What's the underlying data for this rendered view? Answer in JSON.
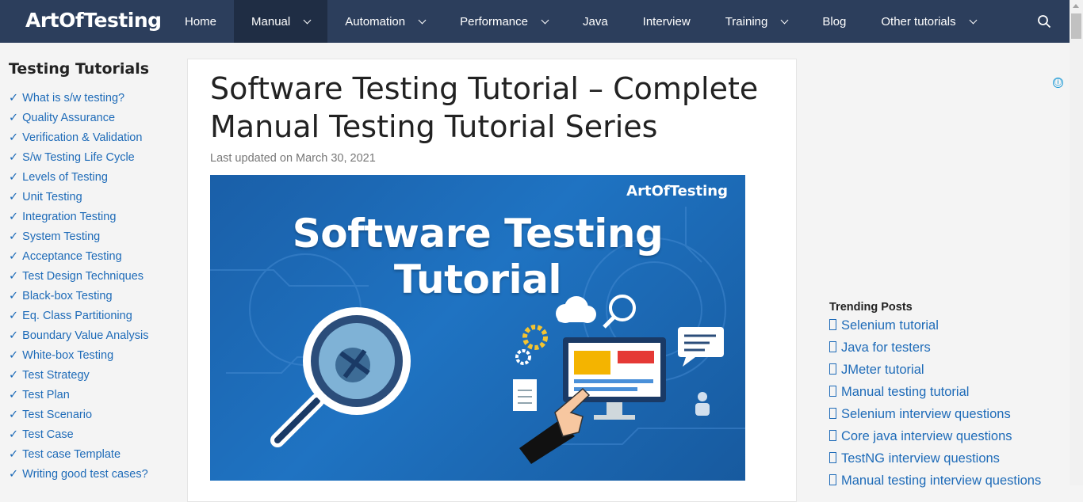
{
  "header": {
    "logo": "ArtOfTesting",
    "nav": [
      {
        "label": "Home",
        "dropdown": false,
        "active": false
      },
      {
        "label": "Manual",
        "dropdown": true,
        "active": true
      },
      {
        "label": "Automation",
        "dropdown": true,
        "active": false
      },
      {
        "label": "Performance",
        "dropdown": true,
        "active": false
      },
      {
        "label": "Java",
        "dropdown": false,
        "active": false
      },
      {
        "label": "Interview",
        "dropdown": false,
        "active": false
      },
      {
        "label": "Training",
        "dropdown": true,
        "active": false
      },
      {
        "label": "Blog",
        "dropdown": false,
        "active": false
      },
      {
        "label": "Other tutorials",
        "dropdown": true,
        "active": false
      }
    ],
    "search_icon": "search-icon"
  },
  "sidebar": {
    "title": "Testing Tutorials",
    "check_mark": "✓",
    "items": [
      "What is s/w testing?",
      "Quality Assurance",
      "Verification & Validation",
      "S/w Testing Life Cycle",
      "Levels of Testing",
      "Unit Testing",
      "Integration Testing",
      "System Testing",
      "Acceptance Testing",
      "Test Design Techniques",
      "Black-box Testing",
      "Eq. Class Partitioning",
      "Boundary Value Analysis",
      "White-box Testing",
      "Test Strategy",
      "Test Plan",
      "Test Scenario",
      "Test Case",
      "Test case Template",
      "Writing good test cases?"
    ]
  },
  "article": {
    "title": "Software Testing Tutorial – Complete Manual Testing Tutorial Series",
    "meta": "Last updated on March 30, 2021",
    "hero": {
      "logo": "ArtOfTesting",
      "title": "Software Testing Tutorial"
    }
  },
  "ad": {
    "info_icon": "ⓘ"
  },
  "trending": {
    "title": "Trending Posts",
    "items": [
      "Selenium tutorial",
      "Java for testers",
      "JMeter tutorial",
      "Manual testing tutorial",
      "Selenium interview questions",
      "Core java interview questions",
      "TestNG interview questions",
      "Manual testing interview questions"
    ]
  },
  "colors": {
    "nav_bg": "#2c3e5c",
    "nav_active": "#1f2d44",
    "link": "#1e6bb8",
    "hero_bg": "#1f73c2"
  }
}
